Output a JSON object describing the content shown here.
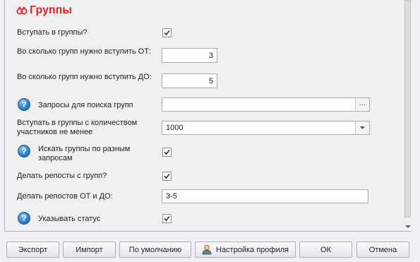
{
  "section": {
    "title": "Группы"
  },
  "fields": {
    "join_groups": {
      "label": "Вступать в группы?",
      "checked": true
    },
    "groups_from": {
      "label": "Во сколько групп нужно вступить ОТ:",
      "value": "3"
    },
    "groups_to": {
      "label": "Во сколько групп нужно вступить ДО:",
      "value": "5"
    },
    "search_queries": {
      "label": "Запросы для поиска групп",
      "value": "",
      "button": "···"
    },
    "min_members": {
      "label": "Вступать в группы с количеством участников не менее",
      "value": "1000"
    },
    "search_by_queries": {
      "label": "Искать группы по разным запросам",
      "checked": true
    },
    "reposts": {
      "label": "Делать репосты с групп?",
      "checked": true
    },
    "reposts_range": {
      "label": "Делать репостов ОТ и ДО:",
      "value": "3-5"
    },
    "set_status": {
      "label": "Указывать статус",
      "checked": true
    }
  },
  "help_glyph": "?",
  "footer": {
    "export": "Экспорт",
    "import": "Импорт",
    "defaults": "По умолчанию",
    "profile": "Настройка профиля",
    "ok": "ОК",
    "cancel": "Отмена"
  },
  "colors": {
    "title": "#e0242a",
    "help_icon": "#2a7fc9"
  }
}
